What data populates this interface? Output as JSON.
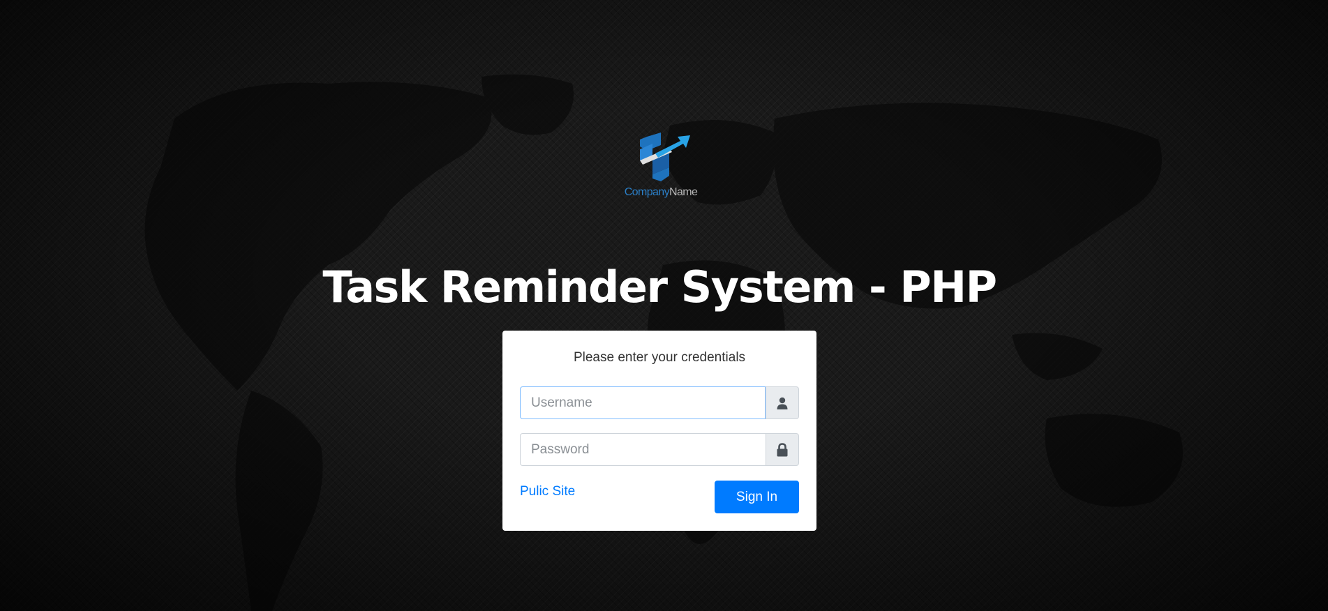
{
  "logo": {
    "company": "Company",
    "name": "Name",
    "colors": {
      "blue": "#1e73be",
      "light_blue": "#29a3e6",
      "gray": "#b8b8b8"
    }
  },
  "title": "Task Reminder System - PHP",
  "login": {
    "message": "Please enter your credentials",
    "username": {
      "placeholder": "Username",
      "value": "",
      "icon": "user-icon"
    },
    "password": {
      "placeholder": "Password",
      "value": "",
      "icon": "lock-icon"
    },
    "public_link": "Pulic Site",
    "sign_in": "Sign In"
  },
  "colors": {
    "background": "#1a1a1a",
    "card": "#ffffff",
    "primary": "#007bff",
    "addon": "#e9ecef",
    "title": "#ffffff"
  }
}
